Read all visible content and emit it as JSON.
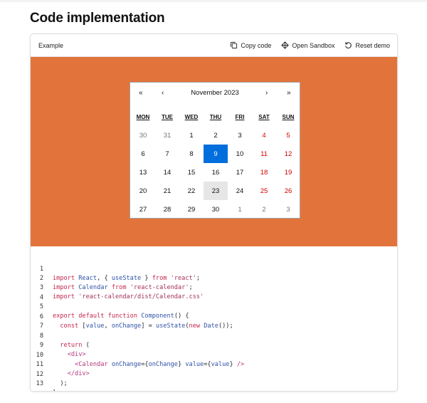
{
  "page": {
    "title": "Code implementation"
  },
  "toolbar": {
    "label": "Example",
    "copy_label": "Copy code",
    "sandbox_label": "Open Sandbox",
    "reset_label": "Reset demo"
  },
  "colors": {
    "demo_bg": "#e2743b",
    "active_day": "#006edc",
    "weekend": "#d10000",
    "keyword": "#c3264d",
    "identifier": "#2f52a6"
  },
  "calendar": {
    "prev2": "«",
    "prev": "‹",
    "title": "November 2023",
    "next": "›",
    "next2": "»",
    "weekdays": [
      "MON",
      "TUE",
      "WED",
      "THU",
      "FRI",
      "SAT",
      "SUN"
    ],
    "weeks": [
      [
        "30",
        "31",
        "1",
        "2",
        "3",
        "4",
        "5"
      ],
      [
        "6",
        "7",
        "8",
        "9",
        "10",
        "11",
        "12"
      ],
      [
        "13",
        "14",
        "15",
        "16",
        "17",
        "18",
        "19"
      ],
      [
        "20",
        "21",
        "22",
        "23",
        "24",
        "25",
        "26"
      ],
      [
        "27",
        "28",
        "29",
        "30",
        "1",
        "2",
        "3"
      ]
    ],
    "selected_day": "9",
    "hovered_day": "23"
  },
  "code": {
    "lines": [
      {
        "n": "1",
        "text": "import React, { useState } from 'react';"
      },
      {
        "n": "2",
        "text": "import Calendar from 'react-calendar';"
      },
      {
        "n": "3",
        "text": "import 'react-calendar/dist/Calendar.css'"
      },
      {
        "n": "4",
        "text": ""
      },
      {
        "n": "5",
        "text": "export default function Component() {"
      },
      {
        "n": "6",
        "text": "  const [value, onChange] = useState(new Date());"
      },
      {
        "n": "7",
        "text": ""
      },
      {
        "n": "8",
        "text": "  return ("
      },
      {
        "n": "9",
        "text": "    <div>"
      },
      {
        "n": "10",
        "text": "      <Calendar onChange={onChange} value={value} />"
      },
      {
        "n": "11",
        "text": "    </div>"
      },
      {
        "n": "12",
        "text": "  );"
      },
      {
        "n": "13",
        "text": "}"
      }
    ]
  }
}
